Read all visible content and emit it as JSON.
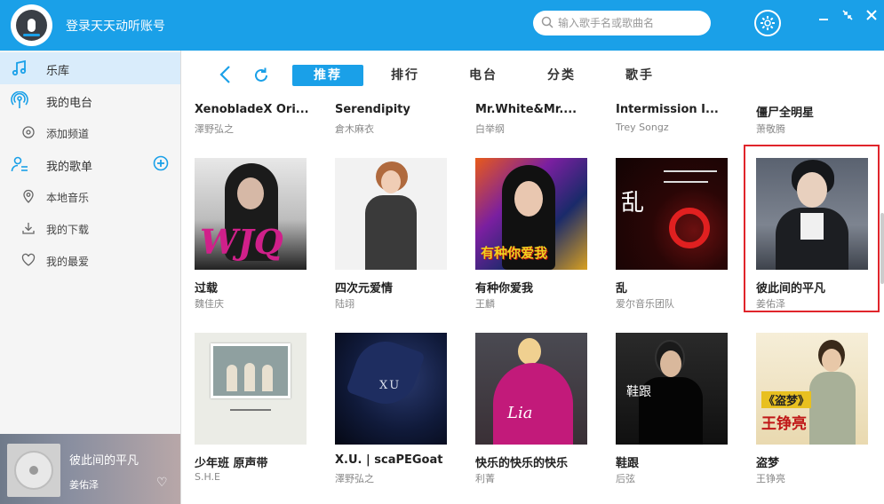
{
  "app": {
    "login_text": "登录天天动听账号",
    "search_placeholder": "输入歌手名或歌曲名"
  },
  "sidebar": {
    "items": [
      {
        "label": "乐库",
        "icon": "music-note-icon"
      },
      {
        "label": "我的电台",
        "icon": "radio-icon"
      },
      {
        "label": "添加频道",
        "icon": "add-channel-icon"
      },
      {
        "label": "我的歌单",
        "icon": "user-playlist-icon"
      },
      {
        "label": "本地音乐",
        "icon": "location-pin-icon"
      },
      {
        "label": "我的下载",
        "icon": "download-icon"
      },
      {
        "label": "我的最爱",
        "icon": "heart-icon"
      }
    ]
  },
  "player": {
    "title": "彼此间的平凡",
    "artist": "姜佑泽"
  },
  "nav": {
    "tabs": [
      "推荐",
      "排行",
      "电台",
      "分类",
      "歌手"
    ],
    "active_tab": "推荐"
  },
  "albums": {
    "row0": [
      {
        "title": "XenobladeX Ori...",
        "artist": "澤野弘之"
      },
      {
        "title": "Serendipity",
        "artist": "倉木麻衣"
      },
      {
        "title": "Mr.White&Mr....",
        "artist": "白举纲"
      },
      {
        "title": "Intermission I...",
        "artist": "Trey Songz"
      },
      {
        "title": "僵尸全明星",
        "artist": "萧敬腾"
      }
    ],
    "row1": [
      {
        "title": "过载",
        "artist": "魏佳庆"
      },
      {
        "title": "四次元爱情",
        "artist": "陆翊"
      },
      {
        "title": "有种你爱我",
        "artist": "王麟"
      },
      {
        "title": "乱",
        "artist": "爱尔音乐团队"
      },
      {
        "title": "彼此间的平凡",
        "artist": "姜佑泽"
      }
    ],
    "row2": [
      {
        "title": "少年班 原声带",
        "artist": "S.H.E"
      },
      {
        "title": "X.U. | scaPEGoat",
        "artist": "澤野弘之"
      },
      {
        "title": "快乐的快乐的快乐",
        "artist": "利菁"
      },
      {
        "title": "鞋跟",
        "artist": "后弦"
      },
      {
        "title": "盗梦",
        "artist": "王铮亮"
      }
    ]
  },
  "cover_text": {
    "r1c0": "WJQ",
    "r1c2": "有种你爱我",
    "r1c3": "乱",
    "r2c1": "XU",
    "r2c3": "鞋跟",
    "r2c4_line1": "《盗梦》",
    "r2c4_line2": "王铮亮"
  },
  "colors": {
    "accent": "#1aa0e8",
    "highlight": "#e0252b"
  }
}
